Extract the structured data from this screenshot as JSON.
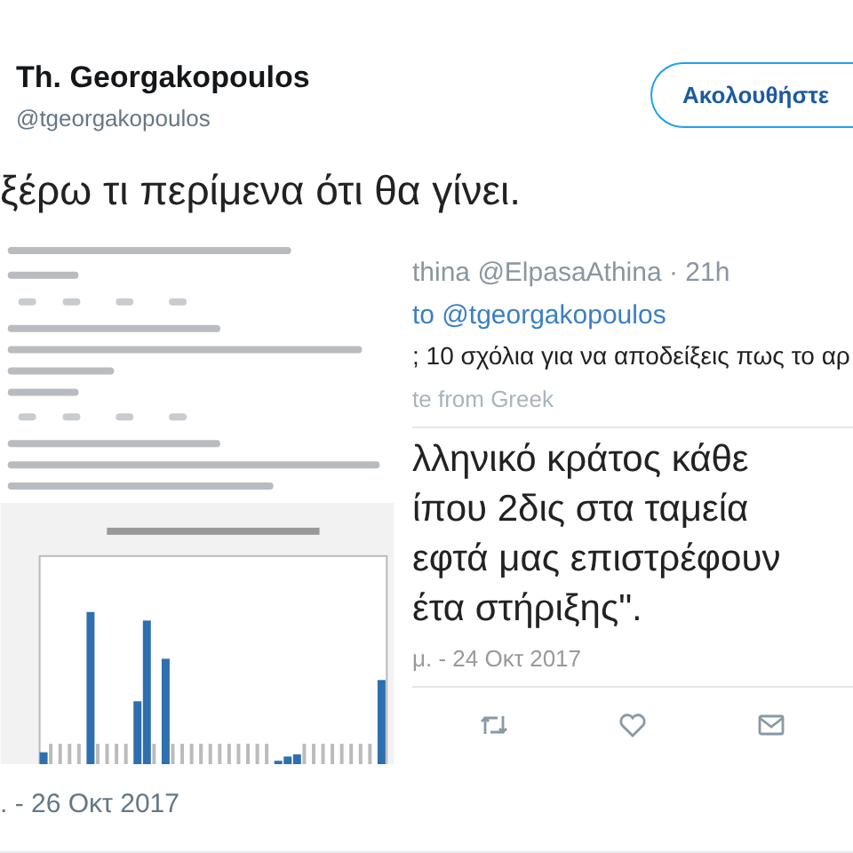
{
  "author": {
    "name": "Th. Georgakopoulos",
    "handle": "@tgeorgakopoulos"
  },
  "follow_button": {
    "label": "Ακολουθήστε"
  },
  "tweet_text": "ξέρω τι περίμενα ότι θα γίνει.",
  "left_image": {
    "kind": "blurred_screenshot"
  },
  "right_image": {
    "kind": "tweet_screenshot",
    "header": "thina @ElpasaAthina · 21h",
    "reply_to": "to @tgeorgakopoulos",
    "text": "; 10 σχόλια για να αποδείξεις πως το αρ",
    "translate": "te from Greek",
    "quote_lines": [
      "λληνικό κράτος κάθε",
      "ίπου 2δις στα ταμεία",
      "εφτά μας επιστρέφουν",
      "έτα στήριξης\"."
    ],
    "date": "μ. - 24 Οκτ 2017"
  },
  "timestamp": ". - 26 Οκτ 2017"
}
